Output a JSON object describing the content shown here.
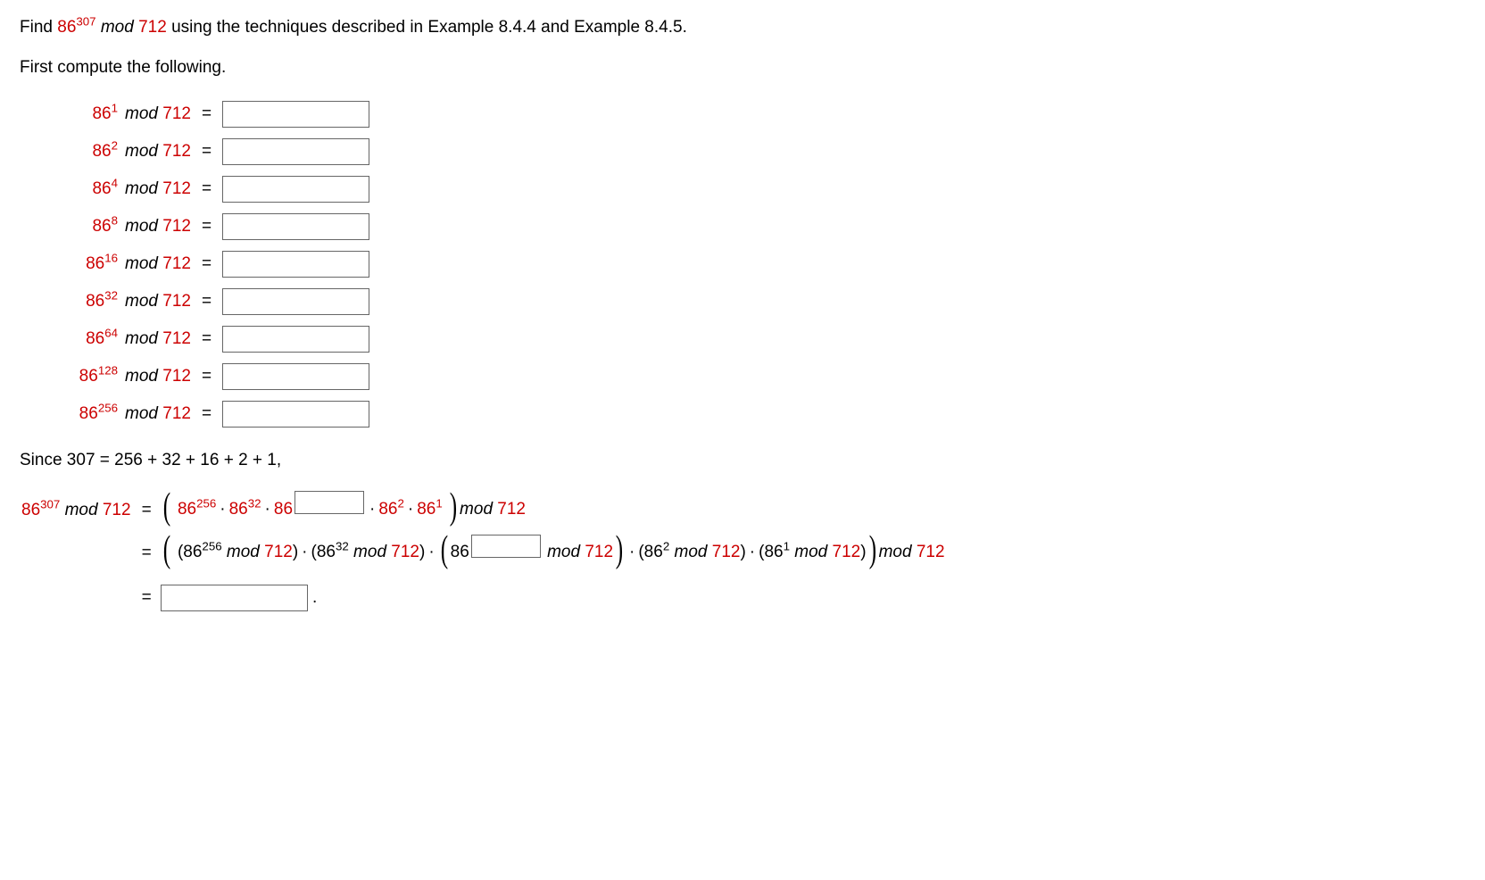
{
  "intro": {
    "prefix": "Find ",
    "base": "86",
    "exp": "307",
    "mid1": " ",
    "mod_word": "mod",
    "mod_n": " 712",
    "suffix": " using the techniques described in Example 8.4.4 and Example 8.4.5."
  },
  "first_compute": "First compute the following.",
  "rows": [
    {
      "base": "86",
      "exp": "1",
      "mod": "mod",
      "n": "712"
    },
    {
      "base": "86",
      "exp": "2",
      "mod": "mod",
      "n": "712"
    },
    {
      "base": "86",
      "exp": "4",
      "mod": "mod",
      "n": "712"
    },
    {
      "base": "86",
      "exp": "8",
      "mod": "mod",
      "n": "712"
    },
    {
      "base": "86",
      "exp": "16",
      "mod": "mod",
      "n": "712"
    },
    {
      "base": "86",
      "exp": "32",
      "mod": "mod",
      "n": "712"
    },
    {
      "base": "86",
      "exp": "64",
      "mod": "mod",
      "n": "712"
    },
    {
      "base": "86",
      "exp": "128",
      "mod": "mod",
      "n": "712"
    },
    {
      "base": "86",
      "exp": "256",
      "mod": "mod",
      "n": "712"
    }
  ],
  "eq": "=",
  "since": "Since 307 = 256 + 32 + 16 + 2 + 1,",
  "calc": {
    "lhs_base": "86",
    "lhs_exp": "307",
    "lhs_mod": "mod",
    "lhs_n": "712",
    "l1": {
      "t1b": "86",
      "t1e": "256",
      "t2b": "86",
      "t2e": "32",
      "t3b": "86",
      "t4b": "86",
      "t4e": "2",
      "t5b": "86",
      "t5e": "1",
      "mod": "mod",
      "n": "712"
    },
    "l2": {
      "p1": "(86",
      "p1e": "256",
      "p1m": " mod ",
      "p1n": "712",
      "p2": "(86",
      "p2e": "32",
      "p2m": " mod ",
      "p2n": "712",
      "p3": "86",
      "p3m": " mod ",
      "p3n": "712",
      "p4": "(86",
      "p4e": "2",
      "p4m": " mod ",
      "p4n": "712",
      "p5": "(86",
      "p5e": "1",
      "p5m": " mod ",
      "p5n": "712",
      "outer_mod": "mod",
      "outer_n": "712"
    },
    "final_period": "."
  }
}
